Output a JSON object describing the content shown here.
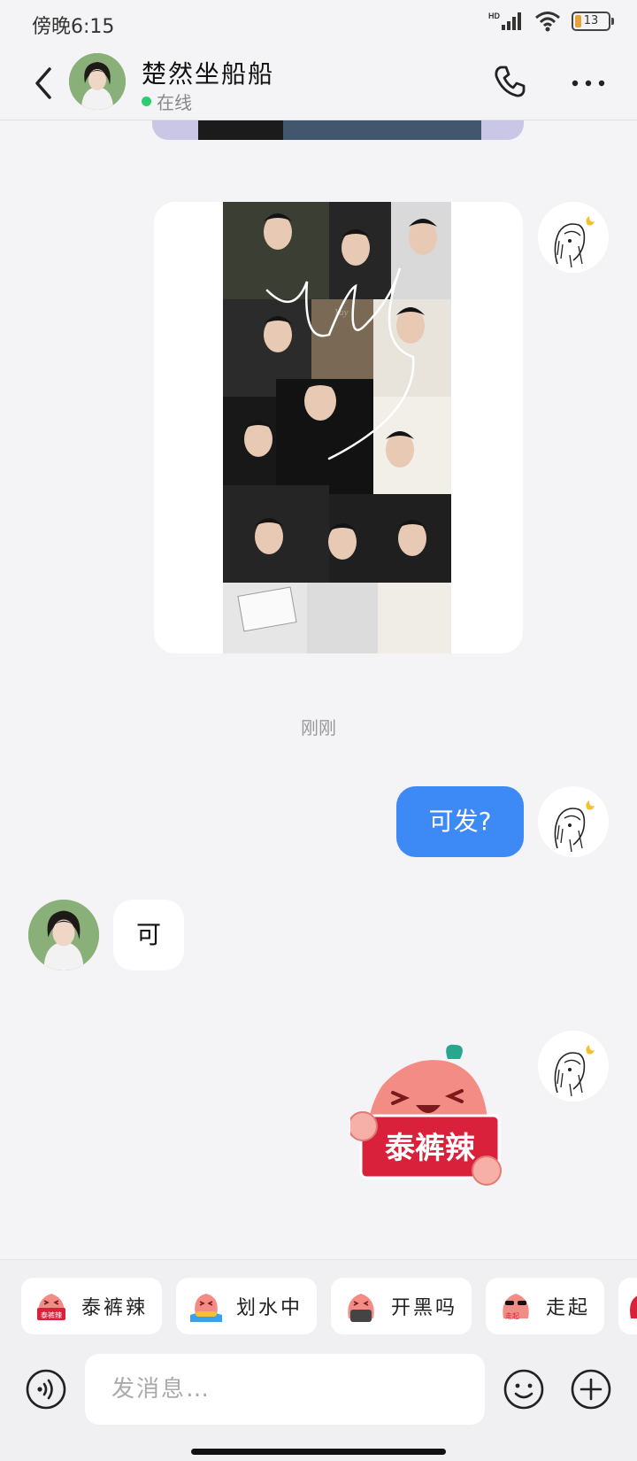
{
  "status_bar": {
    "time": "傍晚6:15",
    "network": "HD",
    "battery_level": "13"
  },
  "header": {
    "contact_name": "楚然坐船船",
    "presence": "在线",
    "icons": [
      "back-arrow-icon",
      "phone-icon",
      "more-icon"
    ]
  },
  "messages": {
    "timestamp": "刚刚",
    "outgoing_text": "可发?",
    "incoming_text": "可",
    "image_signature": "Yay",
    "sticker_text": "泰裤辣"
  },
  "quick_stickers": [
    {
      "label": "泰裤辣",
      "tag": "泰裤辣"
    },
    {
      "label": "划水中",
      "tag": ""
    },
    {
      "label": "开黑吗",
      "tag": ""
    },
    {
      "label": "走起",
      "tag": "走起"
    }
  ],
  "composer": {
    "placeholder": "发消息…",
    "icons": [
      "voice-icon",
      "emoji-icon",
      "plus-icon"
    ]
  },
  "colors": {
    "accent_blue": "#3d8af7",
    "online_green": "#2ecc71",
    "background": "#f4f4f6"
  }
}
